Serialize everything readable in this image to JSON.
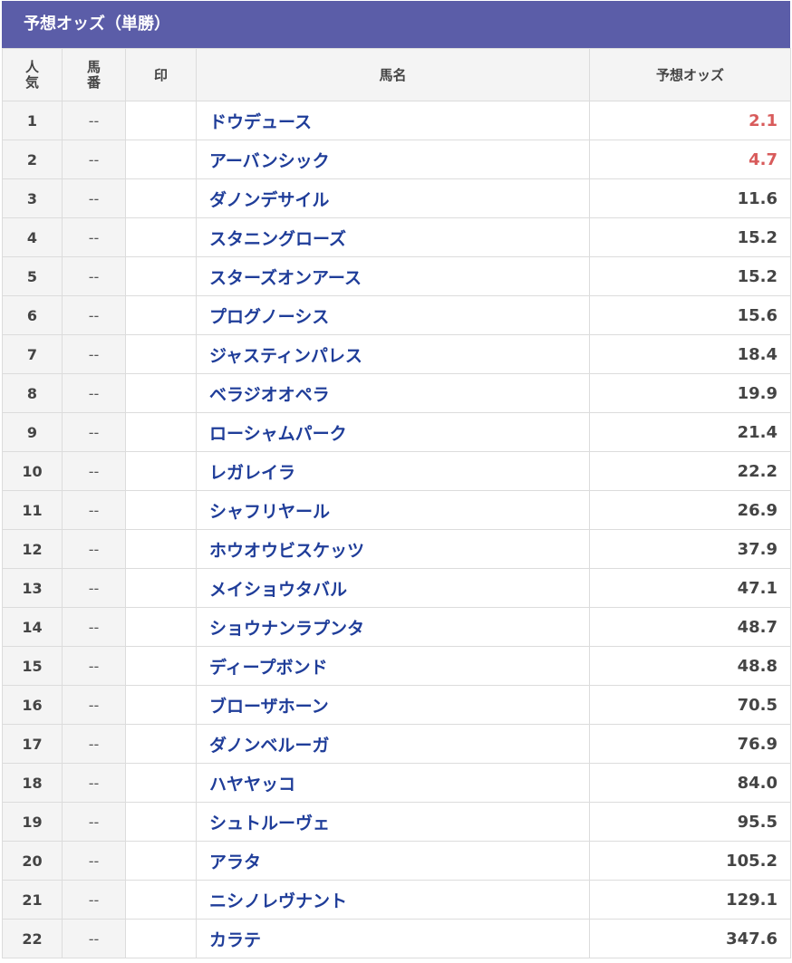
{
  "title": "予想オッズ（単勝）",
  "headers": {
    "ninki_line1": "人",
    "ninki_line2": "気",
    "umaban_line1": "馬",
    "umaban_line2": "番",
    "mark": "印",
    "horse_name": "馬名",
    "odds": "予想オッズ"
  },
  "colors": {
    "title_bg": "#5b5da8",
    "name_text": "#1f3d99",
    "favorite_odds": "#d85b5b"
  },
  "rows": [
    {
      "rank": "1",
      "number": "--",
      "mark": "",
      "name": "ドウデュース",
      "odds": "2.1",
      "hot": true
    },
    {
      "rank": "2",
      "number": "--",
      "mark": "",
      "name": "アーバンシック",
      "odds": "4.7",
      "hot": true
    },
    {
      "rank": "3",
      "number": "--",
      "mark": "",
      "name": "ダノンデサイル",
      "odds": "11.6",
      "hot": false
    },
    {
      "rank": "4",
      "number": "--",
      "mark": "",
      "name": "スタニングローズ",
      "odds": "15.2",
      "hot": false
    },
    {
      "rank": "5",
      "number": "--",
      "mark": "",
      "name": "スターズオンアース",
      "odds": "15.2",
      "hot": false
    },
    {
      "rank": "6",
      "number": "--",
      "mark": "",
      "name": "プログノーシス",
      "odds": "15.6",
      "hot": false
    },
    {
      "rank": "7",
      "number": "--",
      "mark": "",
      "name": "ジャスティンパレス",
      "odds": "18.4",
      "hot": false
    },
    {
      "rank": "8",
      "number": "--",
      "mark": "",
      "name": "ベラジオオペラ",
      "odds": "19.9",
      "hot": false
    },
    {
      "rank": "9",
      "number": "--",
      "mark": "",
      "name": "ローシャムパーク",
      "odds": "21.4",
      "hot": false
    },
    {
      "rank": "10",
      "number": "--",
      "mark": "",
      "name": "レガレイラ",
      "odds": "22.2",
      "hot": false
    },
    {
      "rank": "11",
      "number": "--",
      "mark": "",
      "name": "シャフリヤール",
      "odds": "26.9",
      "hot": false
    },
    {
      "rank": "12",
      "number": "--",
      "mark": "",
      "name": "ホウオウビスケッツ",
      "odds": "37.9",
      "hot": false
    },
    {
      "rank": "13",
      "number": "--",
      "mark": "",
      "name": "メイショウタバル",
      "odds": "47.1",
      "hot": false
    },
    {
      "rank": "14",
      "number": "--",
      "mark": "",
      "name": "ショウナンラプンタ",
      "odds": "48.7",
      "hot": false
    },
    {
      "rank": "15",
      "number": "--",
      "mark": "",
      "name": "ディープボンド",
      "odds": "48.8",
      "hot": false
    },
    {
      "rank": "16",
      "number": "--",
      "mark": "",
      "name": "ブローザホーン",
      "odds": "70.5",
      "hot": false
    },
    {
      "rank": "17",
      "number": "--",
      "mark": "",
      "name": "ダノンベルーガ",
      "odds": "76.9",
      "hot": false
    },
    {
      "rank": "18",
      "number": "--",
      "mark": "",
      "name": "ハヤヤッコ",
      "odds": "84.0",
      "hot": false
    },
    {
      "rank": "19",
      "number": "--",
      "mark": "",
      "name": "シュトルーヴェ",
      "odds": "95.5",
      "hot": false
    },
    {
      "rank": "20",
      "number": "--",
      "mark": "",
      "name": "アラタ",
      "odds": "105.2",
      "hot": false
    },
    {
      "rank": "21",
      "number": "--",
      "mark": "",
      "name": "ニシノレヴナント",
      "odds": "129.1",
      "hot": false
    },
    {
      "rank": "22",
      "number": "--",
      "mark": "",
      "name": "カラテ",
      "odds": "347.6",
      "hot": false
    }
  ]
}
